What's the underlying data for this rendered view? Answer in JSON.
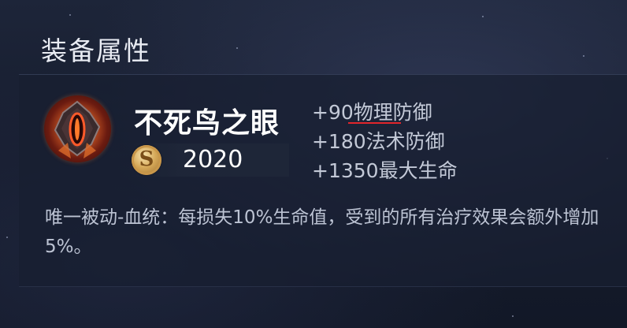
{
  "section": {
    "title": "装备属性"
  },
  "item": {
    "name": "不死鸟之眼",
    "icon": "phoenix-eye-icon",
    "coin_icon_letter": "S",
    "price": "2020",
    "stats": [
      "+90物理防御",
      "+180法术防御",
      "+1350最大生命"
    ],
    "description": "唯一被动-血统：每损失10%生命值，受到的所有治疗效果会额外增加5%。"
  },
  "colors": {
    "background": "#161c2d",
    "panel": "#181f30",
    "stat_text": "#c3c9d7",
    "underline_accent": "#e1252b",
    "icon_glow": "#b44a20",
    "coin_gold": "#d6a959"
  }
}
